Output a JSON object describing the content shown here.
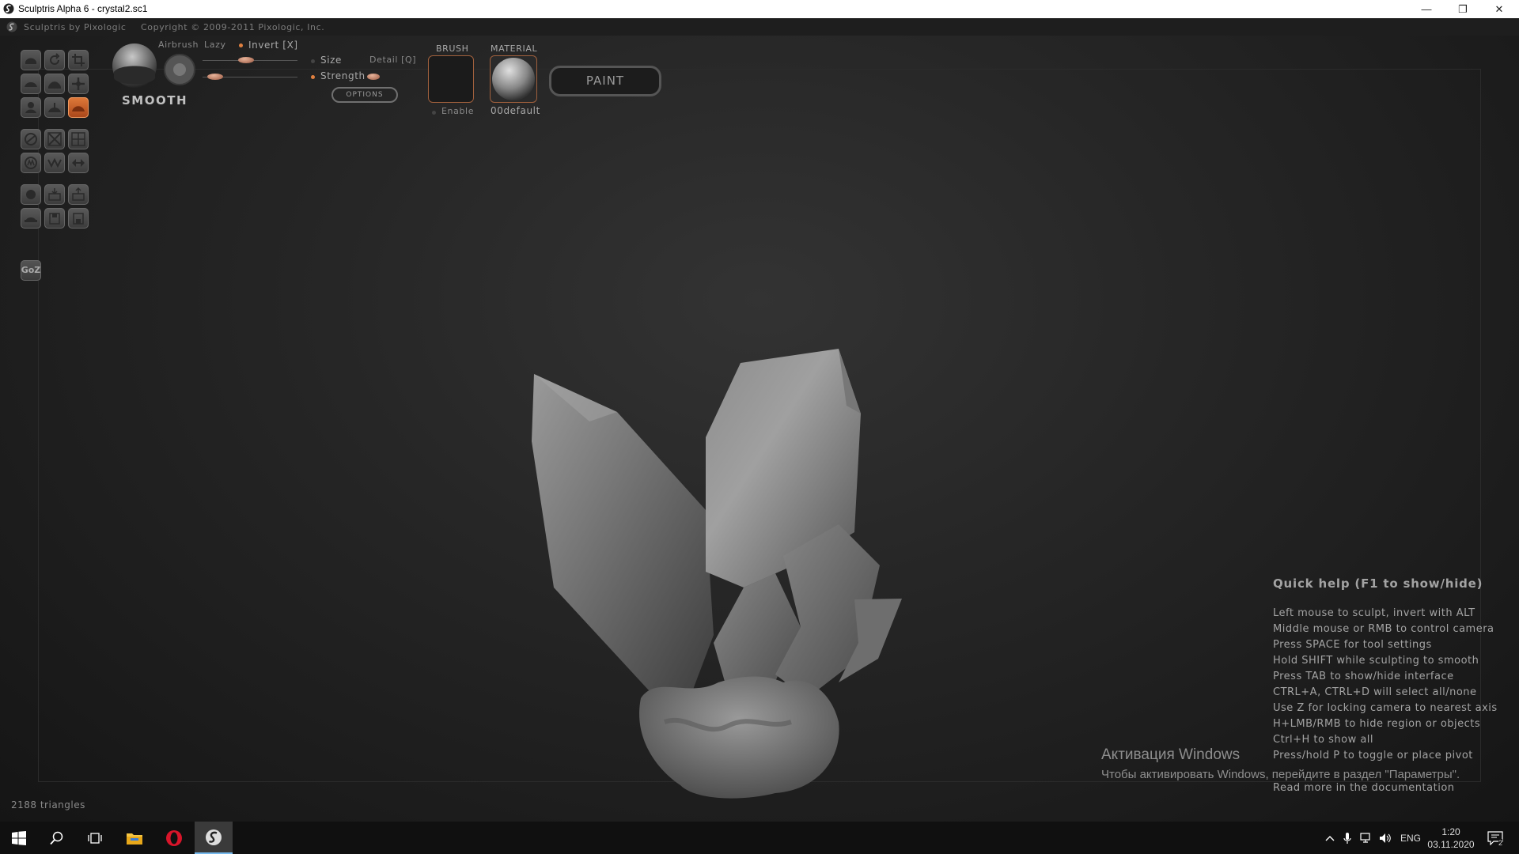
{
  "window": {
    "title": "Sculptris Alpha 6 - crystal2.sc1",
    "buttons": {
      "minimize": "—",
      "restore": "❐",
      "close": "✕"
    }
  },
  "menubar": {
    "brand": "Sculptris by Pixologic",
    "copyright": "Copyright © 2009-2011 Pixologic, Inc."
  },
  "brush_panel": {
    "current_tool": "SMOOTH",
    "airbrush_label": "Airbrush",
    "lazy_label": "Lazy",
    "invert_label": "Invert [X]",
    "size_label": "Size",
    "detail_label": "Detail [Q]",
    "strength_label": "Strength",
    "options_button": "OPTIONS",
    "brush_label": "BRUSH",
    "enable_label": "Enable",
    "material_label": "MATERIAL",
    "material_name": "00default",
    "paint_button": "PAINT",
    "size_value": 0.45,
    "strength_value": 0.06
  },
  "toolbar": {
    "groups": [
      [
        "draw-tool",
        "rotate-tool",
        "crop-tool"
      ],
      [
        "inflate-tool",
        "flatten-tool",
        "grab-tool"
      ],
      [
        "pinch-tool",
        "crease-tool",
        "smooth-tool"
      ],
      [
        "reduce-brush-tool",
        "reduce-selection-tool",
        "subdivide-tool"
      ],
      [
        "symmetry-tool",
        "wireframe-tool",
        "mirror-tool"
      ],
      [
        "sphere-tool",
        "import-obj-tool",
        "export-obj-tool"
      ],
      [
        "plane-tool",
        "open-tool",
        "save-tool"
      ]
    ],
    "goz_label": "GoZ"
  },
  "status": {
    "triangles": "2188 triangles"
  },
  "quick_help": {
    "title": "Quick help (F1 to show/hide)",
    "lines": [
      "Left mouse to sculpt, invert with ALT",
      "Middle mouse or RMB to control camera",
      "Press SPACE for tool settings",
      "Hold SHIFT while sculpting to smooth",
      "Press TAB to show/hide interface",
      "CTRL+A, CTRL+D will select all/none",
      "Use Z for locking camera to nearest axis",
      "H+LMB/RMB to hide region or objects",
      "Ctrl+H to show all",
      "Press/hold P to toggle or place pivot",
      "Read more in the documentation"
    ]
  },
  "activation": {
    "title": "Активация Windows",
    "text": "Чтобы активировать Windows, перейдите в раздел \"Параметры\"."
  },
  "taskbar": {
    "lang": "ENG",
    "time": "1:20",
    "date": "03.11.2020",
    "notifications": "2"
  },
  "colors": {
    "accent": "#e07a3a",
    "panel": "#1e1e1e",
    "taskbar": "#101010"
  }
}
